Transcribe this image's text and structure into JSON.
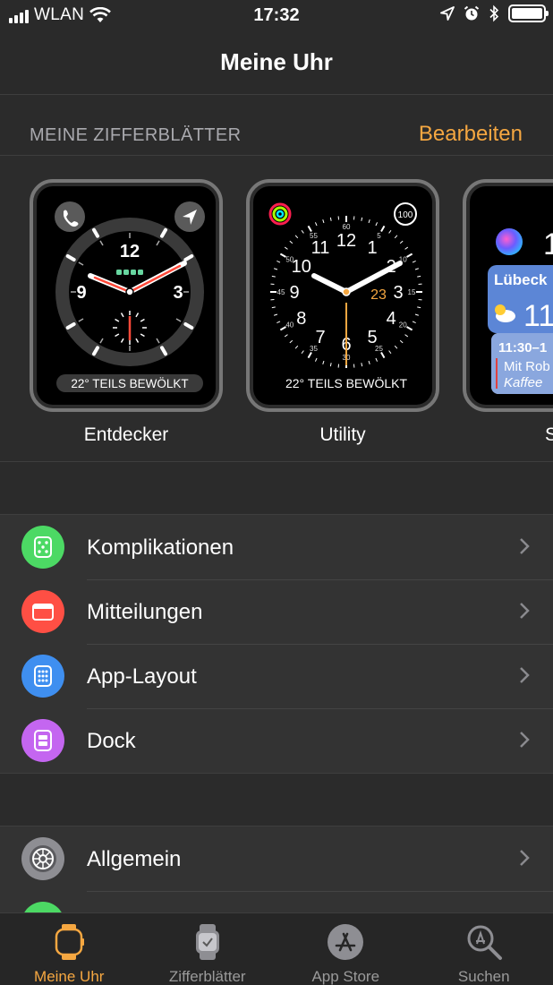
{
  "status_bar": {
    "carrier": "WLAN",
    "time": "17:32",
    "icons": [
      "signal-bars-icon",
      "wifi-icon",
      "location-arrow-icon",
      "alarm-icon",
      "bluetooth-icon",
      "battery-icon"
    ]
  },
  "nav": {
    "title": "Meine Uhr"
  },
  "faces_section": {
    "title": "MEINE ZIFFERBLÄTTER",
    "edit_label": "Bearbeiten"
  },
  "faces": [
    {
      "name": "Entdecker",
      "numbers": [
        "12",
        "3",
        "9"
      ],
      "weather": "22° TEILS BEWÖLKT"
    },
    {
      "name": "Utility",
      "numbers": [
        "12",
        "1",
        "2",
        "3",
        "4",
        "5",
        "6",
        "7",
        "8",
        "9",
        "10",
        "11"
      ],
      "outer_numbers": [
        "5",
        "10",
        "15",
        "20",
        "25",
        "30",
        "35",
        "40",
        "45",
        "50",
        "55",
        "60"
      ],
      "complication_top_right": "100",
      "date": "23",
      "weather": "22° TEILS BEWÖLKT"
    },
    {
      "name": "S",
      "city": "Lübeck",
      "temp": "11",
      "time_digit": "1",
      "event_time": "11:30–1",
      "event_line1": "Mit Rob",
      "event_line2": "Kaffee"
    }
  ],
  "menu_group_1": [
    {
      "label": "Komplikationen",
      "icon": "complications-icon",
      "color": "#4cd964"
    },
    {
      "label": "Mitteilungen",
      "icon": "notifications-icon",
      "color": "#ff4f44"
    },
    {
      "label": "App-Layout",
      "icon": "app-layout-icon",
      "color": "#3f8ff0"
    },
    {
      "label": "Dock",
      "icon": "dock-icon",
      "color": "#c466f0"
    }
  ],
  "menu_group_2": [
    {
      "label": "Allgemein",
      "icon": "gear-icon",
      "color": "#8e8e93"
    }
  ],
  "tabs": [
    {
      "label": "Meine Uhr",
      "icon": "watch-icon",
      "active": true
    },
    {
      "label": "Zifferblätter",
      "icon": "watch-faces-icon",
      "active": false
    },
    {
      "label": "App Store",
      "icon": "app-store-icon",
      "active": false
    },
    {
      "label": "Suchen",
      "icon": "search-icon",
      "active": false
    }
  ],
  "colors": {
    "accent": "#f5a741",
    "background": "#2b2b2b",
    "row_background": "#333333"
  }
}
